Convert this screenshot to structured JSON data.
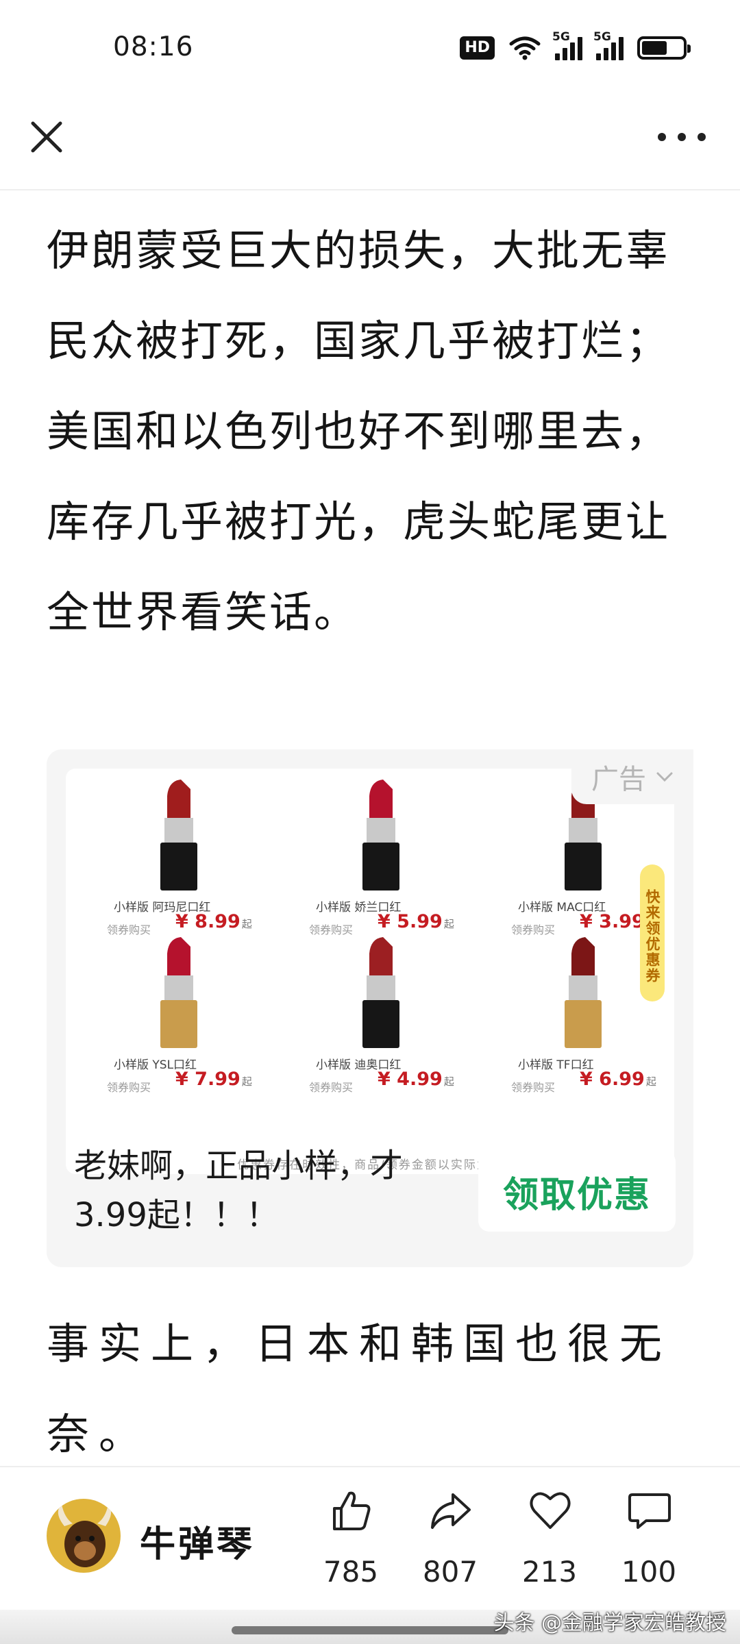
{
  "status_bar": {
    "time": "08:16",
    "hd": "HD",
    "network_1": "5G",
    "network_2": "5G",
    "battery_level": 0.62
  },
  "nav": {
    "close_icon": "close-icon",
    "more_icon": "more-icon"
  },
  "article": {
    "paragraph_1": "伊朗蒙受巨大的损失，大批无辜民众被打死，国家几乎被打烂；美国和以色列也好不到哪里去，库存几乎被打光，虎头蛇尾更让全世界看笑话。",
    "paragraph_2": "事实上，日本和韩国也很无奈。"
  },
  "ad": {
    "label": "广告",
    "coupon_tag": "快来领优惠券",
    "disclaimer": "优惠券存在时效性，商品/领券金额以实际为准",
    "products": [
      {
        "name": "小样版   阿玛尼口红",
        "buy": "领券购买",
        "price": "¥ 8.99",
        "suffix": "起",
        "color": "#a01d1d"
      },
      {
        "name": "小样版   娇兰口红",
        "buy": "领券购买",
        "price": "¥ 5.99",
        "suffix": "起",
        "color": "#b5122d"
      },
      {
        "name": "小样版   MAC口红",
        "buy": "领券购买",
        "price": "¥ 3.99",
        "suffix": "起",
        "color": "#8e1a1a"
      },
      {
        "name": "小样版   YSL口红",
        "buy": "领券购买",
        "price": "¥ 7.99",
        "suffix": "起",
        "color": "#b5122d"
      },
      {
        "name": "小样版   迪奥口红",
        "buy": "领券购买",
        "price": "¥ 4.99",
        "suffix": "起",
        "color": "#9c1f22"
      },
      {
        "name": "小样版   TF口红",
        "buy": "领券购买",
        "price": "¥ 6.99",
        "suffix": "起",
        "color": "#7c1616"
      }
    ],
    "text": "老妹啊，正品小样，才3.99起！！！",
    "cta": "领取优惠"
  },
  "footer": {
    "author": "牛弹琴",
    "like_count": "785",
    "share_count": "807",
    "favorite_count": "213",
    "comment_count": "100"
  },
  "watermark": "头条 @金融学家宏皓教授",
  "colors": {
    "accent_green": "#1aa25c",
    "price_red": "#c51c22"
  }
}
